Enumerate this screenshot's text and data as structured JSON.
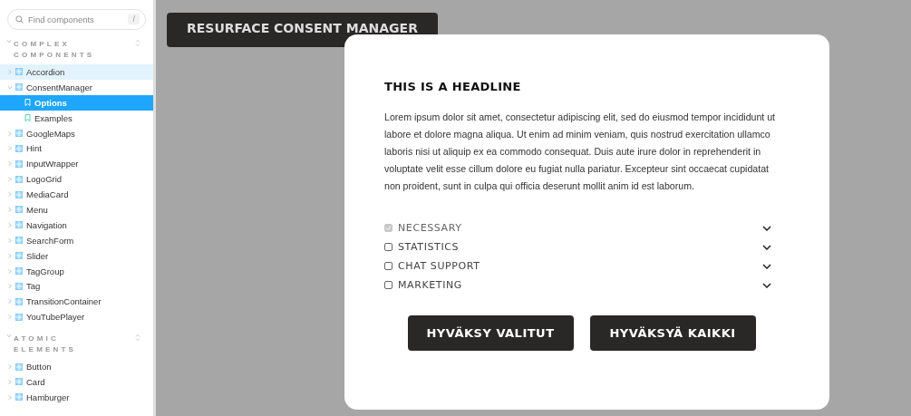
{
  "sidebar": {
    "search": {
      "placeholder": "Find components",
      "shortcut": "/"
    },
    "sections": [
      {
        "title": "COMPLEX COMPONENTS",
        "expanded": true,
        "items": [
          {
            "label": "Accordion",
            "kind": "component",
            "expanded": false,
            "selected": false,
            "hovered": true
          },
          {
            "label": "ConsentManager",
            "kind": "component",
            "expanded": true,
            "selected": false,
            "hovered": false,
            "children": [
              {
                "label": "Options",
                "kind": "story",
                "selected": true
              },
              {
                "label": "Examples",
                "kind": "story",
                "selected": false
              }
            ]
          },
          {
            "label": "GoogleMaps",
            "kind": "component",
            "expanded": false,
            "selected": false,
            "hovered": false
          },
          {
            "label": "Hint",
            "kind": "component",
            "expanded": false,
            "selected": false,
            "hovered": false
          },
          {
            "label": "InputWrapper",
            "kind": "component",
            "expanded": false,
            "selected": false,
            "hovered": false
          },
          {
            "label": "LogoGrid",
            "kind": "component",
            "expanded": false,
            "selected": false,
            "hovered": false
          },
          {
            "label": "MediaCard",
            "kind": "component",
            "expanded": false,
            "selected": false,
            "hovered": false
          },
          {
            "label": "Menu",
            "kind": "component",
            "expanded": false,
            "selected": false,
            "hovered": false
          },
          {
            "label": "Navigation",
            "kind": "component",
            "expanded": false,
            "selected": false,
            "hovered": false
          },
          {
            "label": "SearchForm",
            "kind": "component",
            "expanded": false,
            "selected": false,
            "hovered": false
          },
          {
            "label": "Slider",
            "kind": "component",
            "expanded": false,
            "selected": false,
            "hovered": false
          },
          {
            "label": "TagGroup",
            "kind": "component",
            "expanded": false,
            "selected": false,
            "hovered": false
          },
          {
            "label": "Tag",
            "kind": "component",
            "expanded": false,
            "selected": false,
            "hovered": false
          },
          {
            "label": "TransitionContainer",
            "kind": "component",
            "expanded": false,
            "selected": false,
            "hovered": false
          },
          {
            "label": "YouTubePlayer",
            "kind": "component",
            "expanded": false,
            "selected": false,
            "hovered": false
          }
        ]
      },
      {
        "title": "ATOMIC ELEMENTS",
        "expanded": true,
        "items": [
          {
            "label": "Button",
            "kind": "component",
            "expanded": false,
            "selected": false,
            "hovered": false
          },
          {
            "label": "Card",
            "kind": "component",
            "expanded": false,
            "selected": false,
            "hovered": false
          },
          {
            "label": "Hamburger",
            "kind": "component",
            "expanded": false,
            "selected": false,
            "hovered": false
          }
        ]
      }
    ]
  },
  "canvas": {
    "resurface_button": "RESURFACE CONSENT MANAGER",
    "dialog": {
      "headline": "THIS IS A HEADLINE",
      "body": "Lorem ipsum dolor sit amet, consectetur adipiscing elit, sed do eiusmod tempor incididunt ut labore et dolore magna aliqua. Ut enim ad minim veniam, quis nostrud exercitation ullamco laboris nisi ut aliquip ex ea commodo consequat. Duis aute irure dolor in reprehenderit in voluptate velit esse cillum dolore eu fugiat nulla pariatur. Excepteur sint occaecat cupidatat non proident, sunt in culpa qui officia deserunt mollit anim id est laborum.",
      "categories": [
        {
          "label": "NECESSARY",
          "checked": true,
          "disabled": true,
          "expanded": false
        },
        {
          "label": "STATISTICS",
          "checked": false,
          "disabled": false,
          "expanded": false
        },
        {
          "label": "CHAT SUPPORT",
          "checked": false,
          "disabled": false,
          "expanded": false
        },
        {
          "label": "MARKETING",
          "checked": false,
          "disabled": false,
          "expanded": false
        }
      ],
      "buttons": [
        "HYVÄKSY VALITUT",
        "HYVÄKSYÄ KAIKKI"
      ]
    }
  }
}
